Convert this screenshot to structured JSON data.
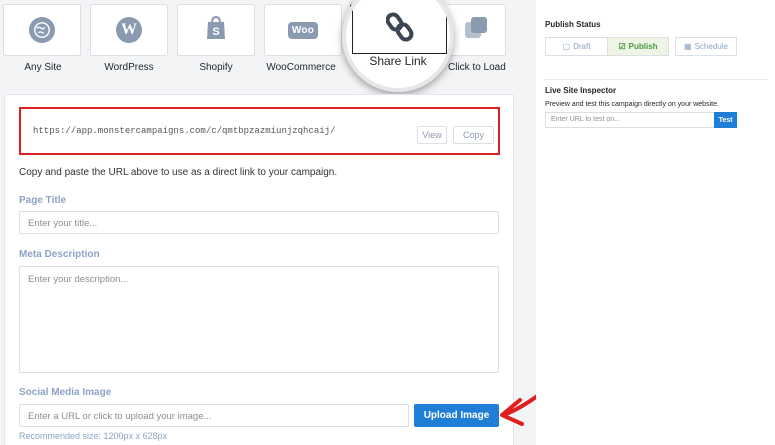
{
  "platforms": [
    {
      "label": "Any Site",
      "icon": "globe-icon"
    },
    {
      "label": "WordPress",
      "icon": "wordpress-icon"
    },
    {
      "label": "Shopify",
      "icon": "shopify-icon"
    },
    {
      "label": "WooCommerce",
      "icon": "woocommerce-icon",
      "badge": "Woo"
    },
    {
      "label": "Share Link",
      "icon": "link-icon"
    },
    {
      "label": "Click to Load",
      "icon": "click-to-load-icon"
    }
  ],
  "share": {
    "url": "https://app.monstercampaigns.com/c/qmtbpzazmiunjzqhcaij/",
    "view_label": "View",
    "copy_label": "Copy",
    "help_text": "Copy and paste the URL above to use as a direct link to your campaign."
  },
  "form": {
    "page_title_label": "Page Title",
    "page_title_placeholder": "Enter your title...",
    "meta_label": "Meta Description",
    "meta_placeholder": "Enter your description...",
    "social_label": "Social Media Image",
    "social_placeholder": "Enter a URL or click to upload your image...",
    "upload_label": "Upload Image",
    "recommended": "Recommended size: 1200px x 628px"
  },
  "publish": {
    "title": "Publish Status",
    "options": [
      "Draft",
      "Publish",
      "Schedule"
    ],
    "active": "Publish"
  },
  "inspector": {
    "title": "Live Site Inspector",
    "description": "Preview and test this campaign directly on your website.",
    "placeholder": "Enter URL to test on...",
    "button": "Test"
  },
  "colors": {
    "accent": "#1f7fd6",
    "highlight": "#e02020",
    "label": "#8aa4c6",
    "icon": "#8a9bb1",
    "success": "#4a9a3c"
  }
}
